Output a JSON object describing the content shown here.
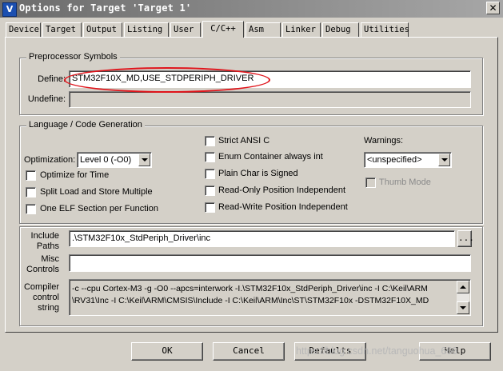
{
  "window": {
    "title": "Options for Target 'Target 1'",
    "icon": "keil-uvision-icon",
    "close_glyph": "✕"
  },
  "tabs": [
    {
      "label": "Device",
      "active": false
    },
    {
      "label": "Target",
      "active": false
    },
    {
      "label": "Output",
      "active": false
    },
    {
      "label": "Listing",
      "active": false
    },
    {
      "label": "User",
      "active": false
    },
    {
      "label": "C/C++",
      "active": true
    },
    {
      "label": "Asm",
      "active": false
    },
    {
      "label": "Linker",
      "active": false
    },
    {
      "label": "Debug",
      "active": false
    },
    {
      "label": "Utilities",
      "active": false
    }
  ],
  "preprocessor": {
    "group_title": "Preprocessor Symbols",
    "define_label": "Define:",
    "define_value": "STM32F10X_MD,USE_STDPERIPH_DRIVER",
    "undefine_label": "Undefine:",
    "undefine_value": ""
  },
  "codegen": {
    "group_title": "Language / Code Generation",
    "optimization_label": "Optimization:",
    "optimization_value": "Level 0 (-O0)",
    "left_checks": [
      {
        "label": "Optimize for Time",
        "checked": false
      },
      {
        "label": "Split Load and Store Multiple",
        "checked": false
      },
      {
        "label": "One ELF Section per Function",
        "checked": false
      }
    ],
    "middle_checks": [
      {
        "label": "Strict ANSI C",
        "checked": false
      },
      {
        "label": "Enum Container always int",
        "checked": false
      },
      {
        "label": "Plain Char is Signed",
        "checked": false
      },
      {
        "label": "Read-Only Position Independent",
        "checked": false
      },
      {
        "label": "Read-Write Position Independent",
        "checked": false
      }
    ],
    "warnings_label": "Warnings:",
    "warnings_value": "<unspecified>",
    "thumb_mode": {
      "label": "Thumb Mode",
      "checked": false,
      "enabled": false
    }
  },
  "paths": {
    "include_label_1": "Include",
    "include_label_2": "Paths",
    "include_value": ".\\STM32F10x_StdPeriph_Driver\\inc",
    "browse_label": "...",
    "misc_label_1": "Misc",
    "misc_label_2": "Controls",
    "misc_value": "",
    "compiler_label_1": "Compiler",
    "compiler_label_2": "control",
    "compiler_label_3": "string",
    "compiler_line_1": "-c --cpu Cortex-M3 -g -O0 --apcs=interwork -I.\\STM32F10x_StdPeriph_Driver\\inc -I C:\\Keil\\ARM",
    "compiler_line_2": "\\RV31\\Inc -I C:\\Keil\\ARM\\CMSIS\\Include -I C:\\Keil\\ARM\\Inc\\ST\\STM32F10x -DSTM32F10X_MD"
  },
  "buttons": {
    "ok": "OK",
    "cancel": "Cancel",
    "defaults": "Defaults",
    "help": "Help"
  },
  "watermark": "https://blog.csdn.net/tanguohua_666",
  "colors": {
    "dialog_bg": "#d4d0c8",
    "annotation": "#e0141b"
  }
}
